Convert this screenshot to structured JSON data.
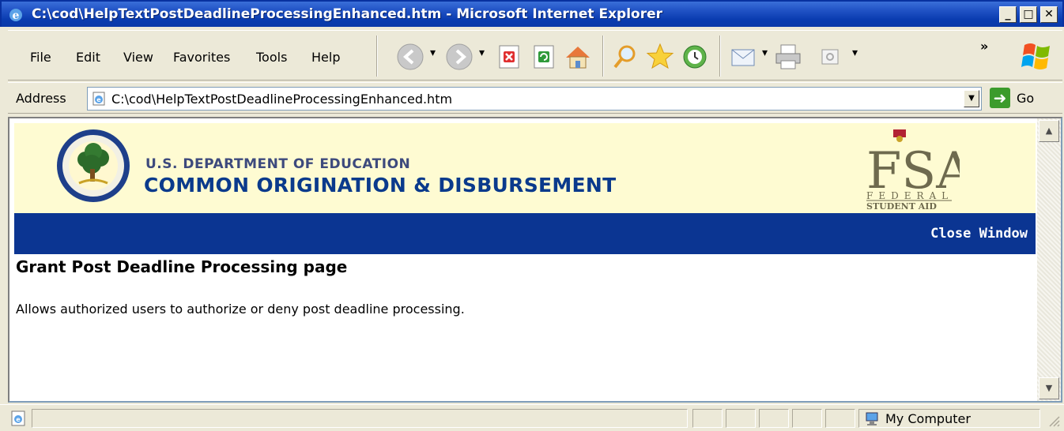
{
  "window": {
    "title": "C:\\cod\\HelpTextPostDeadlineProcessingEnhanced.htm - Microsoft Internet Explorer",
    "minimize_label": "_",
    "maximize_label": "□",
    "close_label": "✕"
  },
  "menu": {
    "items": [
      {
        "label": "File",
        "accel": "F"
      },
      {
        "label": "Edit",
        "accel": "E"
      },
      {
        "label": "View",
        "accel": "V"
      },
      {
        "label": "Favorites",
        "accel": "a"
      },
      {
        "label": "Tools",
        "accel": "T"
      },
      {
        "label": "Help",
        "accel": "H"
      }
    ],
    "overflow": "»"
  },
  "toolbar": {
    "icons": [
      "back-icon",
      "forward-icon",
      "stop-icon",
      "refresh-icon",
      "home-icon",
      "search-icon",
      "favorites-icon",
      "history-icon",
      "mail-icon",
      "print-icon",
      "edit-icon"
    ]
  },
  "address": {
    "label": "Address",
    "url": "C:\\cod\\HelpTextPostDeadlineProcessingEnhanced.htm",
    "go_label": "Go"
  },
  "page": {
    "dept": "U.S. DEPARTMENT OF EDUCATION",
    "system": "COMMON ORIGINATION & DISBURSEMENT",
    "fsa_logo_text": "FSA FEDERAL STUDENT AID",
    "close_window": "Close Window",
    "heading": "Grant Post Deadline Processing page",
    "description": "Allows authorized users to authorize or deny post deadline processing."
  },
  "status": {
    "zone": "My Computer"
  },
  "colors": {
    "header_band": "#fefbd2",
    "nav_band": "#0b3592",
    "titlebar": "#0a3cb0"
  }
}
